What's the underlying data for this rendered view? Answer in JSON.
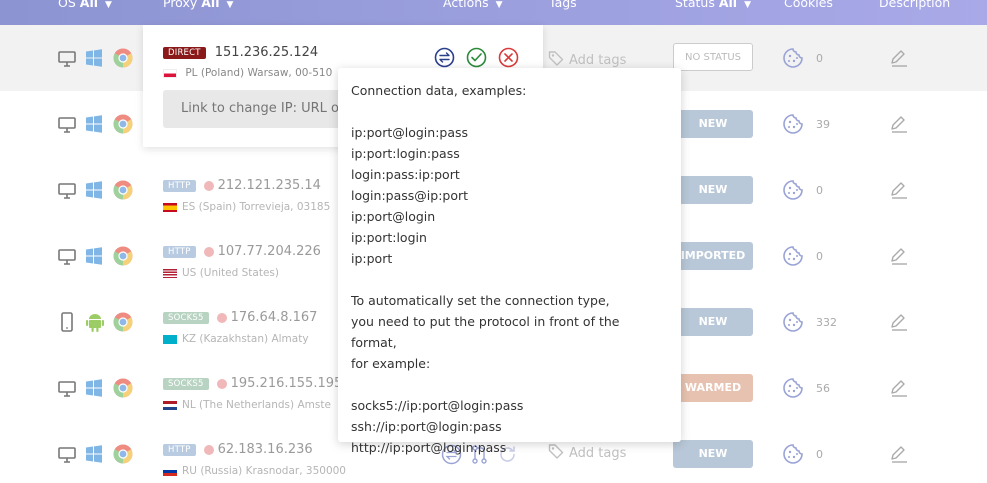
{
  "header": {
    "os_label": "OS",
    "os_value": "All",
    "proxy_label": "Proxy",
    "proxy_value": "All",
    "actions_label": "Actions",
    "tags_label": "Tags",
    "status_label": "Status",
    "status_value": "All",
    "cookies_label": "Cookies",
    "description_label": "Description"
  },
  "rows": [
    {
      "device": "desktop",
      "os": "windows",
      "browser": "chrome",
      "type": "DIRECT",
      "ip": "151.236.25.124",
      "flag": "PL",
      "location": "PL (Poland) Warsaw, 00-510",
      "status": "NO STATUS",
      "status_style": "nostatus",
      "cookies": "0",
      "tags": "Add tags"
    },
    {
      "device": "desktop",
      "os": "windows",
      "browser": "chrome",
      "type": "",
      "ip": "",
      "flag": "",
      "location": "",
      "status": "NEW",
      "status_style": "new",
      "cookies": "39",
      "tags": ""
    },
    {
      "device": "desktop",
      "os": "windows",
      "browser": "chrome",
      "type": "HTTP",
      "ip": "212.121.235.14",
      "flag": "ES",
      "location": "ES (Spain) Torrevieja, 03185",
      "status": "NEW",
      "status_style": "new",
      "cookies": "0",
      "tags": ""
    },
    {
      "device": "desktop",
      "os": "windows",
      "browser": "chrome",
      "type": "HTTP",
      "ip": "107.77.204.226",
      "flag": "US",
      "location": "US (United States)",
      "status": "IMPORTED",
      "status_style": "imported",
      "cookies": "0",
      "tags": ""
    },
    {
      "device": "mobile",
      "os": "android",
      "browser": "chrome",
      "type": "SOCKS5",
      "ip": "176.64.8.167",
      "flag": "KZ",
      "location": "KZ (Kazakhstan) Almaty",
      "status": "NEW",
      "status_style": "new",
      "cookies": "332",
      "tags": ""
    },
    {
      "device": "desktop",
      "os": "windows",
      "browser": "chrome",
      "type": "SOCKS5",
      "ip": "195.216.155.195",
      "flag": "NL",
      "location": "NL (The Netherlands) Amste",
      "status": "WARMED",
      "status_style": "warmed",
      "cookies": "56",
      "tags": ""
    },
    {
      "device": "desktop",
      "os": "windows",
      "browser": "chrome",
      "type": "HTTP",
      "ip": "62.183.16.236",
      "flag": "RU",
      "location": "RU (Russia) Krasnodar, 350000",
      "status": "NEW",
      "status_style": "new",
      "cookies": "0",
      "tags": "Add tags"
    }
  ],
  "edit_card": {
    "link_placeholder": "Link to change IP: URL or"
  },
  "tooltip": {
    "lines": [
      "Connection data, examples:",
      "",
      "ip:port@login:pass",
      "ip:port:login:pass",
      "login:pass:ip:port",
      "login:pass@ip:port",
      "ip:port@login",
      "ip:port:login",
      "ip:port",
      "",
      "To automatically set the connection type,",
      "you need to put the protocol in front of the format,",
      "for example:",
      "",
      "socks5://ip:port@login:pass",
      "ssh://ip:port@login:pass",
      "http://ip:port@login:pass"
    ]
  },
  "colors": {
    "header_start": "#8c94d2",
    "header_end": "#a9a9e8",
    "direct_badge": "#8a1a1a",
    "http_badge": "#b8cbe0",
    "socks_badge": "#b8d3c2",
    "status_new": "#b8c8d8",
    "status_warmed": "#e8c2b0",
    "action_blue": "#2b3f8f",
    "action_green": "#2a8a3a",
    "action_red": "#d93a3a"
  }
}
